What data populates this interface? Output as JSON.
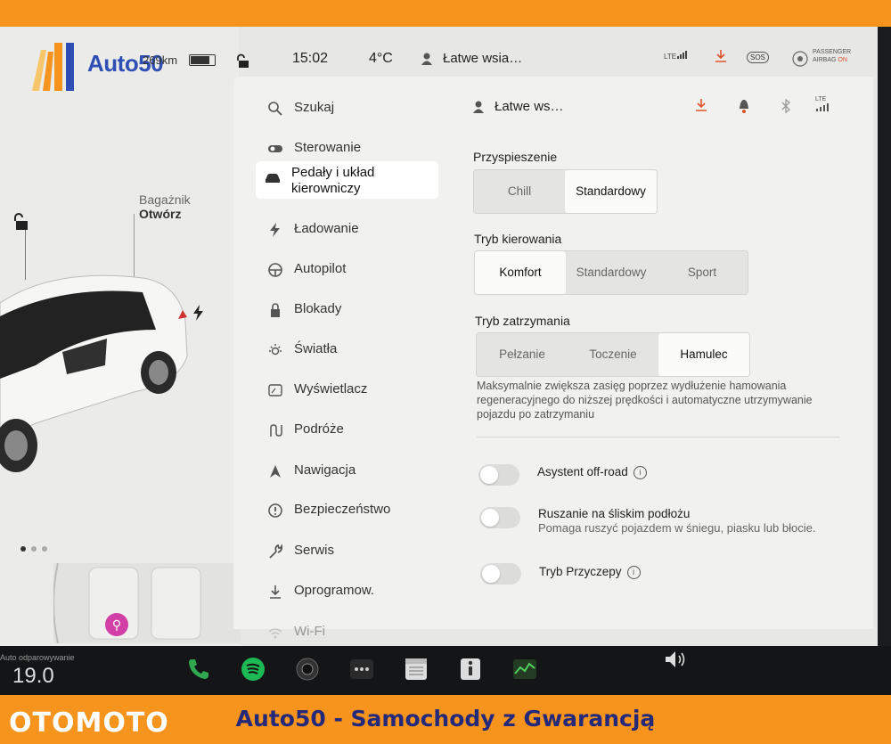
{
  "frame": {
    "watermark": "OTOMOTO",
    "slogan": "Auto50 - Samochody z Gwarancją",
    "brand_colors": {
      "orange": "#f7941d",
      "navy": "#24297a"
    }
  },
  "logo": {
    "text": "Auto50"
  },
  "status_bar": {
    "range": "269km",
    "battery_level": 0.8,
    "time": "15:02",
    "temperature": "4°C",
    "profile": "Łatwe wsia…",
    "network": "LTE",
    "sos": "SOS",
    "airbag_line1": "PASSENGER",
    "airbag_line2": "AIRBAG",
    "airbag_state": "ON"
  },
  "vehicle": {
    "trunk_label": "Bagażnik",
    "trunk_state": "Otwórz"
  },
  "menu": [
    {
      "label": "Szukaj",
      "icon": "search-icon"
    },
    {
      "label": "Sterowanie",
      "icon": "toggle-icon"
    },
    {
      "label": "Pedały i układ kierowniczy",
      "icon": "car-icon"
    },
    {
      "label": "Ładowanie",
      "icon": "bolt-icon"
    },
    {
      "label": "Autopilot",
      "icon": "steering-wheel-icon"
    },
    {
      "label": "Blokady",
      "icon": "lock-icon"
    },
    {
      "label": "Światła",
      "icon": "sun-icon"
    },
    {
      "label": "Wyświetlacz",
      "icon": "display-icon"
    },
    {
      "label": "Podróże",
      "icon": "route-icon"
    },
    {
      "label": "Nawigacja",
      "icon": "navigation-icon"
    },
    {
      "label": "Bezpieczeństwo",
      "icon": "warning-icon"
    },
    {
      "label": "Serwis",
      "icon": "wrench-icon"
    },
    {
      "label": "Oprogramow.",
      "icon": "download-icon"
    },
    {
      "label": "Wi-Fi",
      "icon": "wifi-icon"
    }
  ],
  "settings": {
    "profile": "Łatwe ws…",
    "network": "LTE",
    "acceleration": {
      "title": "Przyspieszenie",
      "options": [
        "Chill",
        "Standardowy"
      ],
      "selected": "Standardowy"
    },
    "steering": {
      "title": "Tryb kierowania",
      "options": [
        "Komfort",
        "Standardowy",
        "Sport"
      ],
      "selected": "Komfort"
    },
    "stopping": {
      "title": "Tryb zatrzymania",
      "options": [
        "Pełzanie",
        "Toczenie",
        "Hamulec"
      ],
      "selected": "Hamulec",
      "description": "Maksymalnie zwiększa zasięg poprzez wydłużenie hamowania regeneracyjnego do niższej prędkości i automatyczne utrzymywanie pojazdu po zatrzymaniu"
    },
    "offroad": {
      "label": "Asystent off-road",
      "info": "i",
      "on": false
    },
    "slip_start": {
      "label": "Ruszanie na śliskim podłożu",
      "sub": "Pomaga ruszyć pojazdem w śniegu, piasku lub błocie.",
      "on": false
    },
    "trailer": {
      "label": "Tryb Przyczepy",
      "info": "i",
      "on": false
    }
  },
  "dock": {
    "odometer_label": "Auto odparowywanie",
    "odometer_value": "19.0",
    "icons": [
      "phone-icon",
      "spotify-icon",
      "camera-icon",
      "more-icon",
      "calendar-icon",
      "manual-icon",
      "energy-icon",
      "volume-icon"
    ]
  }
}
